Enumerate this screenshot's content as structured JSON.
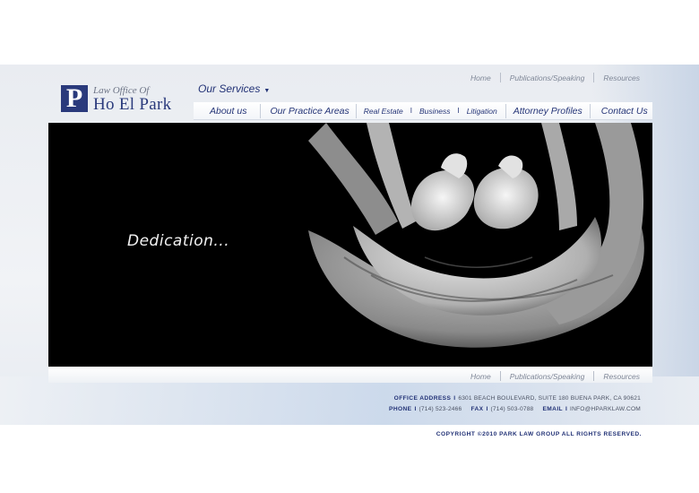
{
  "logo": {
    "letter": "P",
    "line1": "Law Office Of",
    "line2": "Ho El Park"
  },
  "top_links": [
    "Home",
    "Publications/Speaking",
    "Resources"
  ],
  "services_label": "Our Services",
  "nav": {
    "about": "About us",
    "practice_areas": "Our Practice Areas",
    "real_estate": "Real Estate",
    "business": "Business",
    "litigation": "Litigation",
    "pipe": "I",
    "attorney": "Attorney Profiles",
    "contact": "Contact Us"
  },
  "hero": {
    "tagline": "Dedication..."
  },
  "footer": {
    "office_label": "OFFICE ADDRESS",
    "office_value": "6301 BEACH BOULEVARD, SUITE 180 BUENA PARK, CA  90621",
    "phone_label": "PHONE",
    "phone_value": "(714) 523-2466",
    "fax_label": "FAX",
    "fax_value": "(714) 503-0788",
    "email_label": "EMAIL",
    "email_value": "INFO@HPARKLAW.COM",
    "separator": "I",
    "copyright": "COPYRIGHT ©2010 PARK LAW GROUP  ALL RIGHTS RESERVED."
  },
  "colors": {
    "brand": "#2a3a7c",
    "nav_text": "#243477",
    "hero_bg": "#000000"
  },
  "icons": {
    "services_caret": "caret-down-icon",
    "hero_image": "hands-photo"
  }
}
